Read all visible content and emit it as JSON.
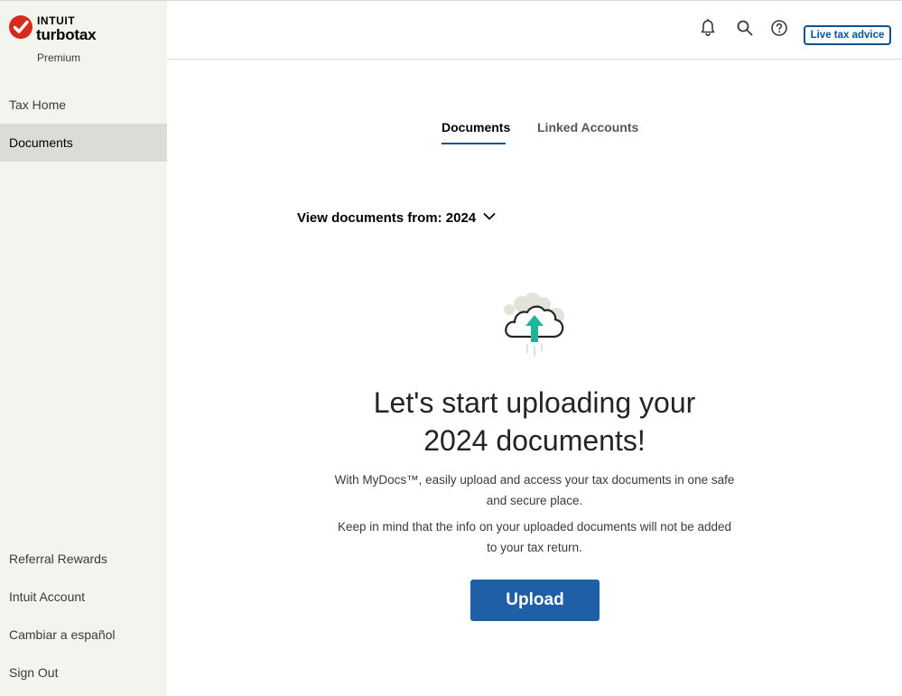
{
  "brand": {
    "company": "INTUIT",
    "product": "turbotax",
    "tier": "Premium",
    "accent_color": "#d52b1e"
  },
  "sidebar": {
    "items": [
      {
        "label": "Tax Home",
        "active": false
      },
      {
        "label": "Documents",
        "active": true
      }
    ],
    "bottom_items": [
      {
        "label": "Referral Rewards"
      },
      {
        "label": "Intuit Account"
      },
      {
        "label": "Cambiar a español"
      },
      {
        "label": "Sign Out"
      }
    ]
  },
  "topbar": {
    "icons": [
      "bell-icon",
      "search-icon",
      "help-icon"
    ],
    "live_advice_label": "Live tax advice"
  },
  "tabs": [
    {
      "label": "Documents",
      "active": true
    },
    {
      "label": "Linked Accounts",
      "active": false
    }
  ],
  "year_selector": {
    "label": "View documents from:",
    "value": "2024"
  },
  "empty_state": {
    "illustration": "cloud-upload-icon",
    "heading_line1": "Let's start uploading your",
    "heading_line2": "2024 documents!",
    "para1_line1": "With MyDocs™, easily upload and access your tax documents in one safe",
    "para1_line2": "and secure place.",
    "para2_line1": "Keep in mind that the info on your uploaded documents will not be added",
    "para2_line2": "to your tax return.",
    "upload_label": "Upload"
  },
  "colors": {
    "primary_blue": "#1f5fa8",
    "link_blue": "#055393",
    "sidebar_bg": "#f4f4ef",
    "teal": "#1fb59a"
  }
}
